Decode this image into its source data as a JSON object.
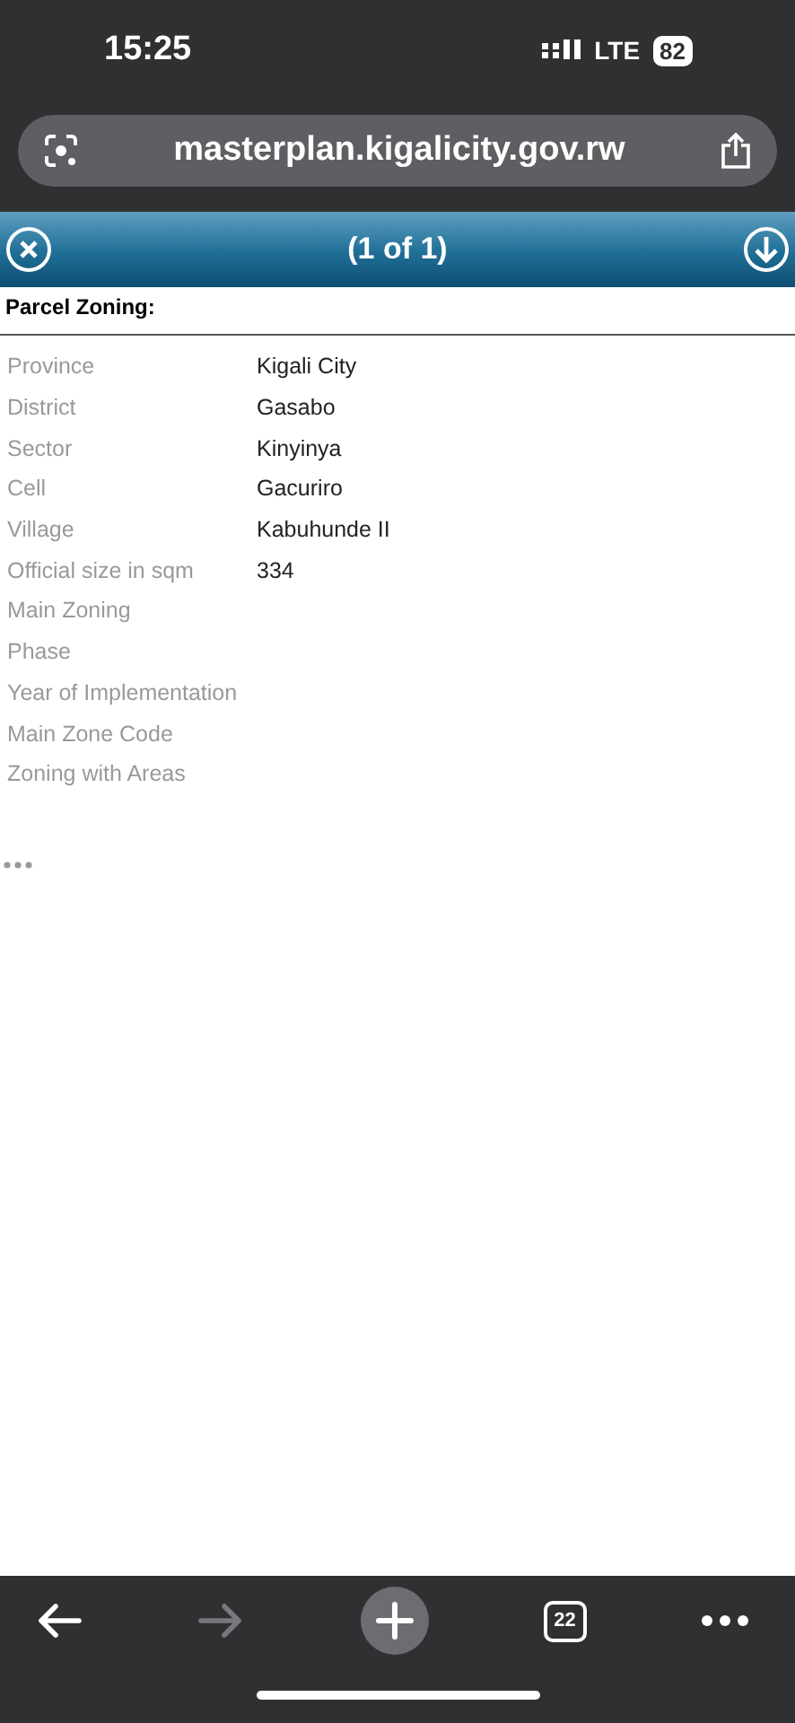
{
  "status_bar": {
    "time": "15:25",
    "network": "LTE",
    "battery": "82"
  },
  "address_bar": {
    "url": "masterplan.kigalicity.gov.rw"
  },
  "popup": {
    "title": "(1 of 1)",
    "heading": "Parcel Zoning:",
    "fields": [
      {
        "label": "Province",
        "value": "Kigali City"
      },
      {
        "label": "District",
        "value": "Gasabo"
      },
      {
        "label": "Sector",
        "value": "Kinyinya"
      },
      {
        "label": "Cell",
        "value": "Gacuriro"
      },
      {
        "label": "Village",
        "value": "Kabuhunde II"
      },
      {
        "label": "Official size in sqm",
        "value": "334"
      },
      {
        "label": "Main Zoning"
      },
      {
        "label": "Phase"
      },
      {
        "label": "Year of Implementation"
      },
      {
        "label": "Main Zone Code"
      },
      {
        "label": "Zoning with Areas"
      }
    ]
  },
  "toolbar": {
    "back_disabled": false,
    "forward_disabled": true,
    "tab_count": "22"
  }
}
